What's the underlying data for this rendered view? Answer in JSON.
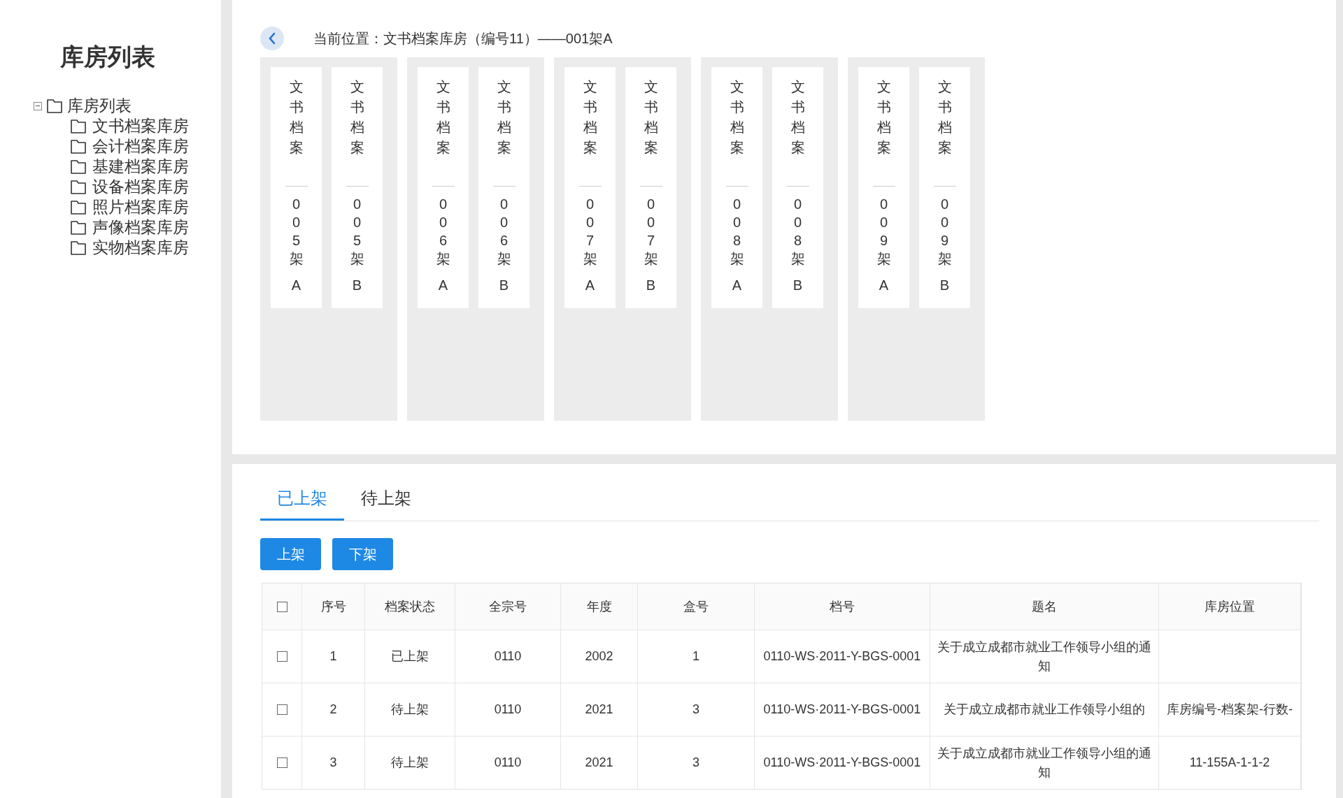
{
  "sidebar": {
    "title": "库房列表",
    "tree": {
      "label": "库房列表",
      "expanded": true,
      "children": [
        {
          "label": "文书档案库房"
        },
        {
          "label": "会计档案库房"
        },
        {
          "label": "基建档案库房"
        },
        {
          "label": "设备档案库房"
        },
        {
          "label": "照片档案库房"
        },
        {
          "label": "声像档案库房"
        },
        {
          "label": "实物档案库房"
        }
      ]
    }
  },
  "breadcrumb": "当前位置：文书档案库房（编号11）——001架A",
  "shelf_groups": [
    {
      "units": [
        {
          "name": "文书档案",
          "code": "005架",
          "side": "A"
        },
        {
          "name": "文书档案",
          "code": "005架",
          "side": "B"
        }
      ]
    },
    {
      "units": [
        {
          "name": "文书档案",
          "code": "006架",
          "side": "A"
        },
        {
          "name": "文书档案",
          "code": "006架",
          "side": "B"
        }
      ]
    },
    {
      "units": [
        {
          "name": "文书档案",
          "code": "007架",
          "side": "A"
        },
        {
          "name": "文书档案",
          "code": "007架",
          "side": "B"
        }
      ]
    },
    {
      "units": [
        {
          "name": "文书档案",
          "code": "008架",
          "side": "A"
        },
        {
          "name": "文书档案",
          "code": "008架",
          "side": "B"
        }
      ]
    },
    {
      "units": [
        {
          "name": "文书档案",
          "code": "009架",
          "side": "A"
        },
        {
          "name": "文书档案",
          "code": "009架",
          "side": "B"
        }
      ]
    }
  ],
  "tabs": [
    {
      "label": "已上架",
      "selected": true
    },
    {
      "label": "待上架",
      "selected": false
    }
  ],
  "buttons": [
    "上架",
    "下架"
  ],
  "table": {
    "header_checked": false,
    "columns": [
      "序号",
      "档案状态",
      "全宗号",
      "年度",
      "盒号",
      "档号",
      "题名",
      "库房位置"
    ],
    "rows": [
      {
        "checked": false,
        "cells": [
          "1",
          "已上架",
          "0110",
          "2002",
          "1",
          "0110-WS·2011-Y-BGS-0001",
          "关于成立成都市就业工作领导小组的通知"
        ]
      },
      {
        "checked": false,
        "cells": [
          "2",
          "待上架",
          "0110",
          "2021",
          "3",
          "0110-WS·2011-Y-BGS-0001",
          "关于成立成都市就业工作领导小组的",
          "库房编号-档案架-行数-"
        ]
      },
      {
        "checked": false,
        "cells": [
          "3",
          "待上架",
          "0110",
          "2021",
          "3",
          "0110-WS·2011-Y-BGS-0001",
          "关于成立成都市就业工作领导小组的通知",
          "11-155A-1-1-2"
        ]
      }
    ]
  }
}
